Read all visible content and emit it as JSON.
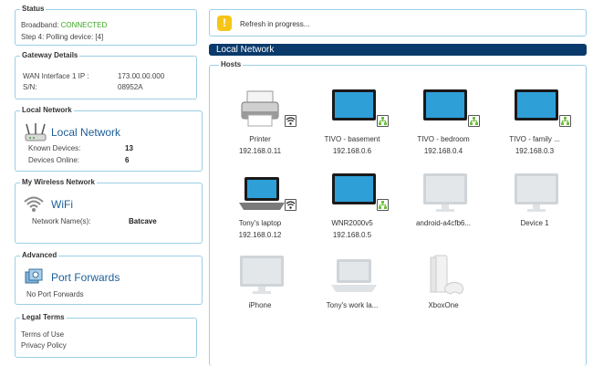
{
  "status": {
    "title": "Status",
    "broadband_label": "Broadband:",
    "broadband_value": "CONNECTED",
    "step_text": "Step 4: Polling device: [4]"
  },
  "gateway": {
    "title": "Gateway Details",
    "wan_label": "WAN Interface 1 IP :",
    "wan_value": "173.00.00.000",
    "sn_label": "S/N:",
    "sn_value": "08952A"
  },
  "local_network": {
    "title": "Local Network",
    "link": "Local Network",
    "known_label": "Known Devices:",
    "known_value": "13",
    "online_label": "Devices Online:",
    "online_value": "6"
  },
  "wireless": {
    "title": "My Wireless Network",
    "link": "WiFi",
    "name_label": "Network Name(s):",
    "name_value": "Batcave"
  },
  "advanced": {
    "title": "Advanced",
    "link": "Port Forwards",
    "note": "No Port Forwards"
  },
  "legal": {
    "title": "Legal Terms",
    "terms": "Terms of Use",
    "privacy": "Privacy Policy"
  },
  "notice": {
    "text": "Refresh in progress..."
  },
  "section_title": "Local Network",
  "hosts_title": "Hosts",
  "hosts": [
    {
      "name": "Printer",
      "ip": "192.168.0.11",
      "icon": "printer-icon",
      "online": true,
      "badge": "wifi"
    },
    {
      "name": "TIVO - basement",
      "ip": "192.168.0.6",
      "icon": "monitor-icon",
      "online": true,
      "badge": "wired"
    },
    {
      "name": "TIVO - bedroom",
      "ip": "192.168.0.4",
      "icon": "monitor-icon",
      "online": true,
      "badge": "wired"
    },
    {
      "name": "TIVO - family ...",
      "ip": "192.168.0.3",
      "icon": "monitor-icon",
      "online": true,
      "badge": "wired"
    },
    {
      "name": "Tony's laptop",
      "ip": "192.168.0.12",
      "icon": "laptop-icon",
      "online": true,
      "badge": "wifi"
    },
    {
      "name": "WNR2000v5",
      "ip": "192.168.0.5",
      "icon": "monitor-icon",
      "online": true,
      "badge": "wired"
    },
    {
      "name": "android-a4cfb6...",
      "ip": "",
      "icon": "monitor-icon",
      "online": false,
      "badge": ""
    },
    {
      "name": "Device 1",
      "ip": "",
      "icon": "monitor-icon",
      "online": false,
      "badge": ""
    },
    {
      "name": "iPhone",
      "ip": "",
      "icon": "monitor-icon",
      "online": false,
      "badge": ""
    },
    {
      "name": "Tony's work la...",
      "ip": "",
      "icon": "laptop-icon",
      "online": false,
      "badge": ""
    },
    {
      "name": "XboxOne",
      "ip": "",
      "icon": "console-icon",
      "online": false,
      "badge": ""
    }
  ],
  "colors": {
    "border": "#9ccfe6",
    "section_bar": "#0a3a6b",
    "link": "#1d5e97",
    "connected": "#39a81e",
    "warning": "#f5c518",
    "badge_wired": "#6fbf3a"
  }
}
